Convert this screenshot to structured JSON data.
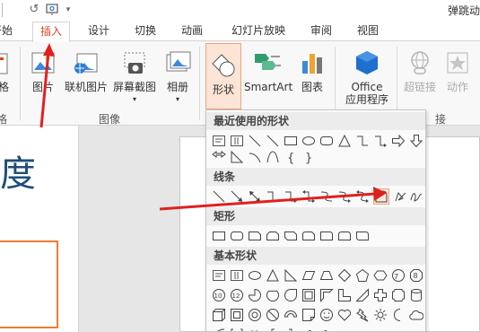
{
  "title_bar": {
    "window_title": "弹跳动"
  },
  "tabs": [
    {
      "id": "start",
      "label": "开始"
    },
    {
      "id": "insert",
      "label": "插入"
    },
    {
      "id": "design",
      "label": "设计"
    },
    {
      "id": "transitions",
      "label": "切换"
    },
    {
      "id": "animations",
      "label": "动画"
    },
    {
      "id": "slideshow",
      "label": "幻灯片放映"
    },
    {
      "id": "review",
      "label": "审阅"
    },
    {
      "id": "view",
      "label": "视图"
    }
  ],
  "ribbon": {
    "partial_left_label": "格",
    "partial_left_group": "格",
    "picture": "图片",
    "online_picture": "联机图片",
    "screenshot": "屏幕截图",
    "album": "相册",
    "images_group": "图像",
    "shapes": "形状",
    "smartart": "SmartArt",
    "chart": "图表",
    "office_apps_line1": "Office",
    "office_apps_line2": "应用程序",
    "hyperlink": "超链接",
    "action": "动作",
    "links_group_partial": "接"
  },
  "slide": {
    "title_partial": "度"
  },
  "shapes_menu": {
    "recent_header": "最近使用的形状",
    "lines_header": "线条",
    "rect_header": "矩形",
    "basic_header": "基本形状"
  },
  "colors": {
    "accent": "#d24726",
    "arrow": "#e02020",
    "highlight_fill": "#fce4d6",
    "slide_border": "#ed7d31",
    "slide_text": "#1f4e79"
  }
}
